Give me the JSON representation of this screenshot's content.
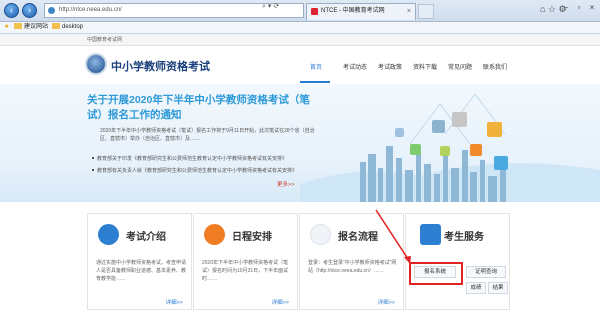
{
  "browser": {
    "address_url": "http://ntce.neea.edu.cn/",
    "tab_title": "NTCE - 中国教育考试网",
    "favorites_bar": {
      "suggested_sites": "建议网站",
      "desktop": "desktop"
    }
  },
  "site": {
    "top_strip": "中国教育考试网",
    "title": "中小学教师资格考试",
    "menu": [
      "首页",
      "考试动态",
      "考试政策",
      "资料下载",
      "常见问题",
      "联系我们"
    ]
  },
  "banner": {
    "headline": "关于开展2020年下半年中小学教师资格考试（笔试）报名工作的通知",
    "body": "2020年下半年中小学教师资格考试（笔试）报名工作将于9月11日开始，此次笔试在28个省（自治区、直辖市）举办（自治区、直辖市）及……",
    "bullets": [
      "教育部关于印发《教育部研究生和公费师范生教育认定中小学教师资格考试有关安排》",
      "教育部有关负责人就《教育部研究生和公费师范生教育认定中小学教师资格考试有关安排》"
    ],
    "more": "更多>>"
  },
  "cards": [
    {
      "title": "考试介绍",
      "text": "通过实施中小学教师资格考试，考查申请人是否具备教师职业道德、基本素养、教育教学能……",
      "more": "详细>>"
    },
    {
      "title": "日程安排",
      "text": "2020年下半年中小学教师资格考试（笔试）报名时间为10月31日，下半年面试时……",
      "more": "详细>>"
    },
    {
      "title": "报名流程",
      "text": "登录：考生登录“中小学教师资格考试”网站（http://ntce.neea.edu.cn）……",
      "more": "详细>>"
    },
    {
      "title": "考生服务",
      "buttons": [
        "报名系统",
        "证明查询",
        "成绩",
        "结果"
      ]
    }
  ],
  "colors": {
    "accent": "#2a7ad1",
    "headline": "#2e9ad8",
    "highlight_box": "#e02222"
  }
}
